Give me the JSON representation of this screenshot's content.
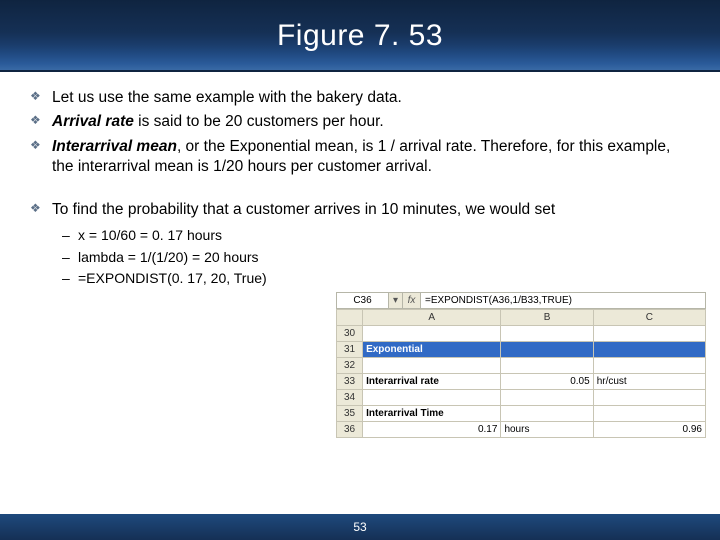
{
  "title": "Figure 7. 53",
  "bullets": {
    "b1": "Let us use the same example with the bakery data.",
    "b2_strong": "Arrival rate",
    "b2_rest": " is said to be 20 customers per hour.",
    "b3_strong": "Interarrival mean",
    "b3_rest": ", or the Exponential mean, is 1 / arrival rate. Therefore, for this example, the interarrival mean is 1/20 hours per customer arrival.",
    "b4": "To find the probability that a customer arrives in 10 minutes, we would set"
  },
  "sub": {
    "s1": "x = 10/60 = 0. 17 hours",
    "s2": "lambda = 1/(1/20) = 20 hours",
    "s3": "=EXPONDIST(0. 17, 20, True)"
  },
  "excel": {
    "name_box": "C36",
    "fx_label": "fx",
    "formula": "=EXPONDIST(A36,1/B33,TRUE)",
    "cols": {
      "A": "A",
      "B": "B",
      "C": "C"
    },
    "rows": {
      "r30": "30",
      "r31": "31",
      "a31": "Exponential",
      "r32": "32",
      "r33": "33",
      "a33": "Interarrival rate",
      "b33": "0.05",
      "c33": "hr/cust",
      "r34": "34",
      "r35": "35",
      "a35": "Interarrival Time",
      "r36": "36",
      "a36": "0.17",
      "b36": "hours",
      "c36": "0.96"
    }
  },
  "page_number": "53"
}
